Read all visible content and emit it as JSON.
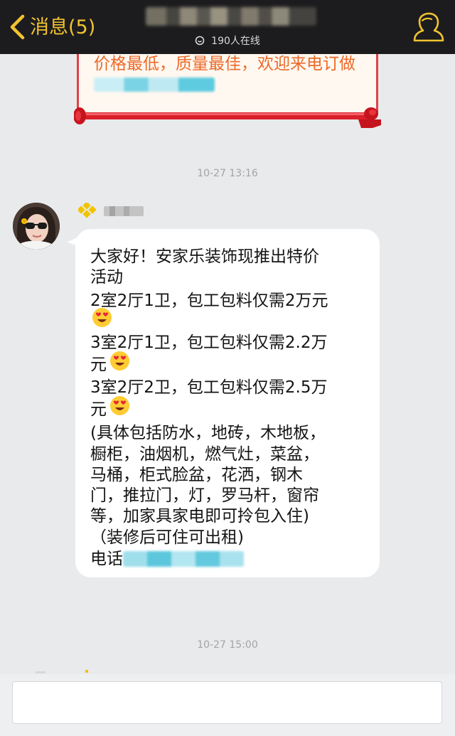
{
  "header": {
    "back_label": "消息(5)",
    "online_text": "190人在线"
  },
  "card": {
    "text": "价格最低，质量最佳，欢迎来电订做"
  },
  "timestamps": [
    "10-27 13:16",
    "10-27 15:00"
  ],
  "message": {
    "lines": [
      "大家好！安家乐装饰现推出特价",
      "活动",
      "2室2厅1卫，包工包料仅需2万元",
      "3室2厅1卫，包工包料仅需2.2万",
      "元",
      "3室2厅2卫，包工包料仅需2.5万",
      "元",
      "(具体包括防水，地砖，木地板，",
      "橱柜，油烟机，燃气灶，菜盆，",
      "马桶，柜式脸盆，花洒，钢木",
      "门，推拉门，灯，罗马杆，窗帘",
      "等，加家具家电即可拎包入住)",
      "（装修后可住可出租)",
      "电话"
    ]
  },
  "icons": {
    "back": "chevron-left-icon",
    "online": "online-ring-icon",
    "profile": "group-members-icon",
    "emoji": "heart-eyes-emoji-icon"
  },
  "colors": {
    "topbar": "#1c1c1e",
    "accent": "#f2c230",
    "background": "#e9eaec",
    "bubble": "#ffffff",
    "card_text": "#ec6a2a",
    "card_border": "#e0414a"
  }
}
